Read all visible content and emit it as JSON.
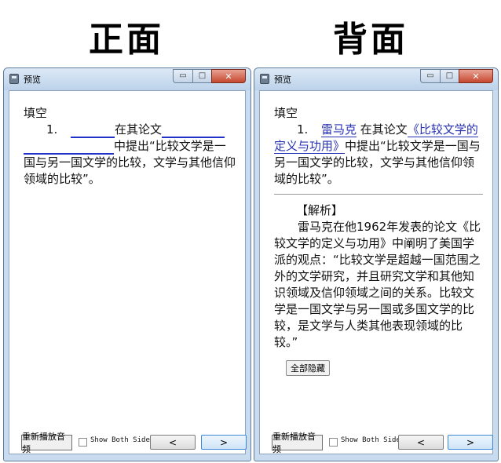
{
  "labels": {
    "front": "正面",
    "back": "背面"
  },
  "window": {
    "title": "预览",
    "controls": {
      "minimize": "▭",
      "maximize": "□",
      "close": "✕"
    }
  },
  "front": {
    "heading": "填空",
    "question": {
      "number": "1.",
      "text1": "在其论文",
      "text2": "中提出“比较文学是一国与另一国文学的比较，文学与其他信仰领域的比较”。"
    }
  },
  "back": {
    "heading": "填空",
    "question": {
      "number": "1.",
      "answer1": "雷马克",
      "text1": "在其论文",
      "answer2": "《比较文学的定义与功用》",
      "text2": "中提出“比较文学是一国与另一国文学的比较，文学与其他信仰领域的比较”。"
    },
    "analysis": {
      "title": "【解析】",
      "body": "雷马克在他1962年发表的论文《比较文学的定义与功用》中阐明了美国学派的观点：“比较文学是超越一国范围之外的文学研究，并且研究文学和其他知识领域及信仰领域之间的关系。比较文学是一国文学与另一国或多国文学的比较，是文学与人类其他表现领域的比较。”"
    },
    "hide_button": "全部隐藏"
  },
  "bottom": {
    "replay_button": "重新播放音频",
    "show_both_label": "Show Both Sides",
    "show_both_checked": false,
    "prev": "<",
    "next": ">"
  }
}
